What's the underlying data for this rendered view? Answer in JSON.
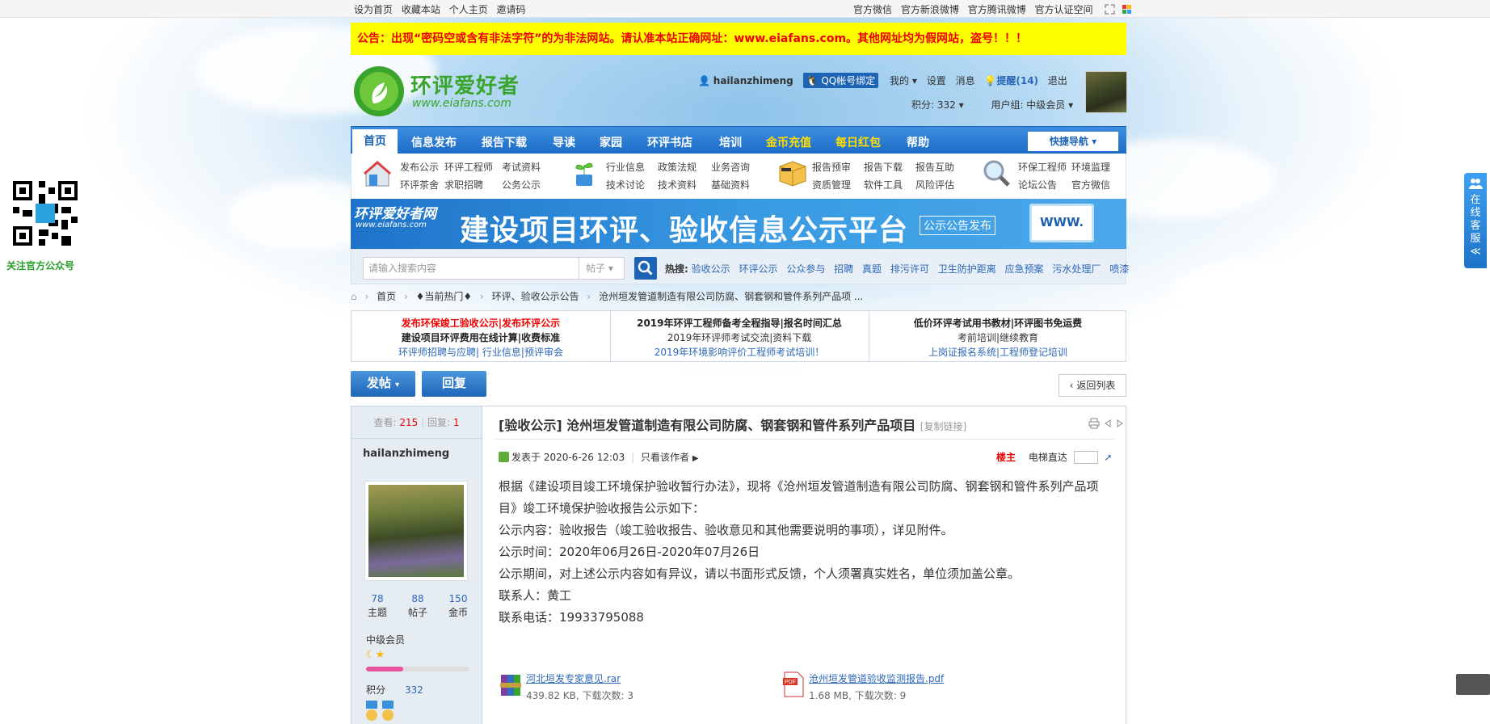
{
  "topbar": {
    "left": [
      "设为首页",
      "收藏本站",
      "个人主页",
      "邀请码"
    ],
    "right": [
      "官方微信",
      "官方新浪微博",
      "官方腾讯微博",
      "官方认证空间"
    ]
  },
  "notice": "公告：出现“密码空或含有非法字符”的为非法网站。请认准本站正确网址：www.eiafans.com。其他网址均为假网站，盗号！！！",
  "logo": {
    "title": "环评爱好者",
    "url": "www.eiafans.com"
  },
  "user": {
    "name": "hailanzhimeng",
    "qq": "QQ帐号绑定",
    "mine": "我的",
    "settings": "设置",
    "messages": "消息",
    "remind": "提醒(14)",
    "logout": "退出",
    "points": "积分: 332",
    "group": "用户组: 中级会员"
  },
  "nav": {
    "items": [
      "首页",
      "信息发布",
      "报告下载",
      "导读",
      "家园",
      "环评书店",
      "培训",
      "金币充值",
      "每日红包",
      "帮助"
    ],
    "quick": "快捷导航"
  },
  "subnav": {
    "g1": [
      "发布公示",
      "环评工程师",
      "考试资料",
      "环评茶舍",
      "求职招聘",
      "公务公示"
    ],
    "g2": [
      "行业信息",
      "政策法规",
      "业务咨询",
      "技术讨论",
      "技术资料",
      "基础资料"
    ],
    "g3": [
      "报告预审",
      "报告下载",
      "报告互助",
      "资质管理",
      "软件工具",
      "风险评估"
    ],
    "g4": [
      "环保工程师",
      "环境监理",
      "论坛公告",
      "官方微信"
    ]
  },
  "banner": {
    "logo": "环评爱好者网",
    "url": "www.eiafans.com",
    "title": "建设项目环评、验收信息公示平台",
    "btn": "公示公告发布",
    "screen": "WWW."
  },
  "search": {
    "placeholder": "请输入搜索内容",
    "type": "帖子",
    "hot_label": "热搜:",
    "hot": [
      "验收公示",
      "环评公示",
      "公众参与",
      "招聘",
      "真题",
      "排污许可",
      "卫生防护距离",
      "应急预案",
      "污水处理厂",
      "喷漆"
    ]
  },
  "crumb": [
    "首页",
    "♦当前热门♦",
    "环评、验收公示公告",
    "沧州垣发管道制造有限公司防腐、钢套钢和管件系列产品项 ..."
  ],
  "ads": [
    [
      "发布环保竣工验收公示|发布环评公示",
      "建设项目环评费用在线计算|收费标准",
      "环评师招聘与应聘| 行业信息|预评审会"
    ],
    [
      "2019年环评工程师备考全程指导|报名时间汇总",
      "2019年环评师考试交流|资料下载",
      "2019年环境影响评价工程师考试培训！"
    ],
    [
      "低价环评考试用书教材|环评图书免运费",
      "考前培训|继续教育",
      "上岗证报名系统|工程师登记培训"
    ]
  ],
  "buttons": {
    "post": "发帖",
    "reply": "回复",
    "back": "返回列表"
  },
  "thread": {
    "views_label": "查看:",
    "views": "215",
    "replies_label": "回复:",
    "replies": "1",
    "title": "[验收公示] 沧州垣发管道制造有限公司防腐、钢套钢和管件系列产品项目",
    "copy": "[复制链接]",
    "author": "hailanzhimeng",
    "posted": "发表于 2020-6-26 12:03",
    "only_author": "只看该作者",
    "floor": "楼主",
    "elevator": "电梯直达",
    "body": [
      "根据《建设项目竣工环境保护验收暂行办法》，现将《沧州垣发管道制造有限公司防腐、钢套钢和管件系列产品项目》竣工环境保护验收报告公示如下：",
      "公示内容：验收报告（竣工验收报告、验收意见和其他需要说明的事项），详见附件。",
      "公示时间：2020年06月26日-2020年07月26日",
      "公示期间，对上述公示内容如有异议，请以书面形式反馈，个人须署真实姓名，单位须加盖公章。",
      "联系人：黄工",
      "联系电话：19933795088"
    ],
    "attachments": [
      {
        "name": "河北垣发专家意见.rar",
        "info": "439.82 KB, 下载次数: 3"
      },
      {
        "name": "沧州垣发管道验收监测报告.pdf",
        "info": "1.68 MB, 下载次数: 9"
      }
    ]
  },
  "profile": {
    "stats": [
      {
        "v": "78",
        "k": "主题"
      },
      {
        "v": "88",
        "k": "帖子"
      },
      {
        "v": "150",
        "k": "金币"
      }
    ],
    "level": "中级会员",
    "level_progress": 0.36,
    "points_label": "积分",
    "points": "332"
  },
  "side": {
    "qr_label": "关注官方公众号",
    "kefu": "在线客服"
  }
}
